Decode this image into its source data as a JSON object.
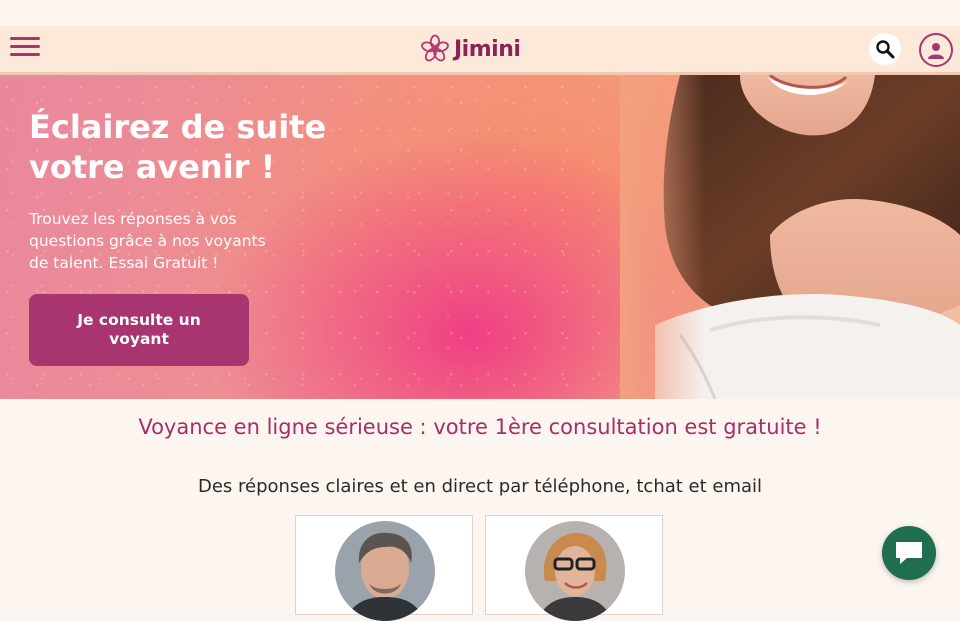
{
  "brand": {
    "name": "Jimini",
    "logo_icon": "flower-logo-icon",
    "color": "#8a2455"
  },
  "header": {
    "menu_icon": "hamburger-menu-icon",
    "search_icon": "search-icon",
    "account_icon": "user-account-icon"
  },
  "hero": {
    "title_line1": "Éclairez de suite",
    "title_line2": "votre avenir !",
    "subtitle": "Trouvez les réponses à vos questions grâce à nos voyants de talent. Essai Gratuit !",
    "cta_label": "Je consulte un voyant"
  },
  "main": {
    "headline": "Voyance en ligne sérieuse : votre 1ère consultation est gratuite !",
    "subline": "Des réponses claires et en direct par téléphone, tchat et email"
  },
  "experts": [
    {
      "avatar": "expert-photo-man"
    },
    {
      "avatar": "expert-photo-woman"
    }
  ],
  "chat": {
    "icon": "chat-bubble-icon"
  },
  "colors": {
    "accent": "#a8356f",
    "headline": "#a52f68",
    "header_bg": "#fde9da",
    "chat_bg": "#1f6e4f"
  }
}
